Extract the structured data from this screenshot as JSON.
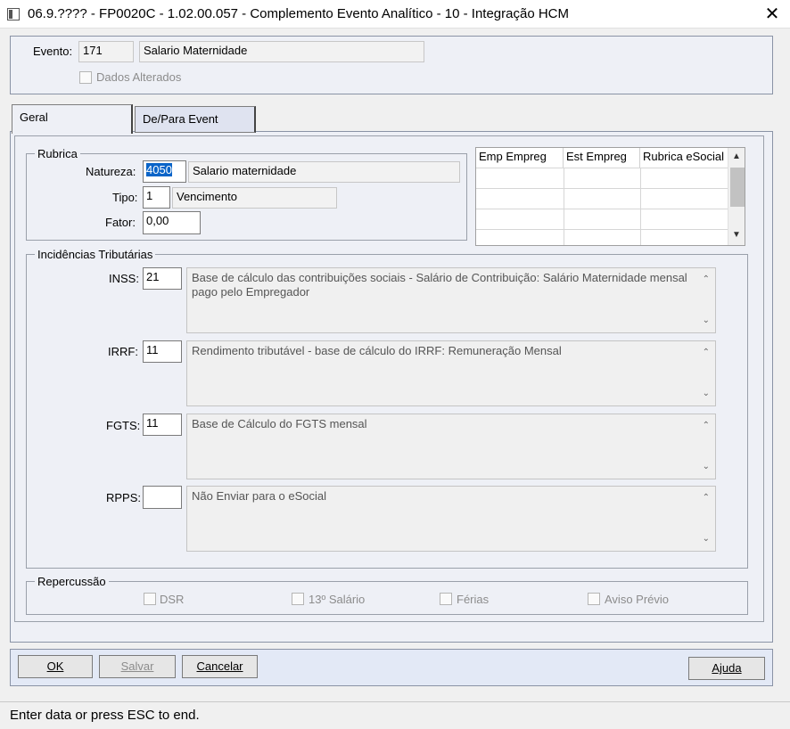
{
  "window": {
    "title": "06.9.???? - FP0020C - 1.02.00.057 - Complemento Evento Analítico - 10 - Integração HCM",
    "close_glyph": "✕"
  },
  "evento": {
    "label": "Evento:",
    "code": "171",
    "description": "Salario Maternidade",
    "dados_alterados_label": "Dados Alterados"
  },
  "tabs": [
    {
      "label": "Geral"
    },
    {
      "label": "De/Para Event"
    }
  ],
  "rubrica": {
    "group_label": "Rubrica",
    "natureza_label": "Natureza:",
    "natureza_value": "4050",
    "natureza_desc": "Salario maternidade",
    "tipo_label": "Tipo:",
    "tipo_value": "1",
    "tipo_desc": "Vencimento",
    "fator_label": "Fator:",
    "fator_value": "0,00"
  },
  "grid": {
    "columns": [
      "Emp Empreg",
      "Est Empreg",
      "Rubrica eSocial"
    ]
  },
  "incidencias": {
    "group_label": "Incidências Tributárias",
    "inss_label": "INSS:",
    "inss_value": "21",
    "inss_desc": "Base de cálculo das contribuições sociais - Salário de Contribuição: Salário Maternidade mensal pago pelo Empregador",
    "irrf_label": "IRRF:",
    "irrf_value": "11",
    "irrf_desc": "Rendimento tributável - base de cálculo do IRRF: Remuneração Mensal",
    "fgts_label": "FGTS:",
    "fgts_value": "11",
    "fgts_desc": "Base de Cálculo do FGTS mensal",
    "rpps_label": "RPPS:",
    "rpps_value": "",
    "rpps_desc": "Não Enviar para o eSocial"
  },
  "repercussao": {
    "group_label": "Repercussão",
    "dsr": "DSR",
    "salario13": "13º Salário",
    "ferias": "Férias",
    "aviso": "Aviso Prévio"
  },
  "buttons": {
    "ok": "OK",
    "salvar": "Salvar",
    "cancelar": "Cancelar",
    "ajuda": "Ajuda"
  },
  "status": {
    "text": "Enter data or press ESC to end."
  }
}
